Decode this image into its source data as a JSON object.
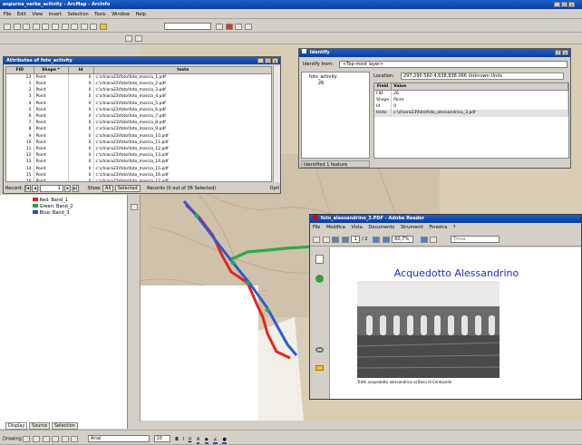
{
  "app": {
    "title": "anpurna_verbe_activity - ArcMap - ArcInfo",
    "menus": [
      "File",
      "Edit",
      "View",
      "Insert",
      "Selection",
      "Tools",
      "Window",
      "Help"
    ]
  },
  "attributes": {
    "title": "Attributes of foto_activity",
    "columns": [
      "FID",
      "Shape *",
      "Id",
      "testo"
    ],
    "rows": [
      [
        "23",
        "Point",
        "0",
        "c:\\chiara23\\foto\\foto_marcia_1.pdf"
      ],
      [
        "1",
        "Point",
        "0",
        "c:\\chiara23\\foto\\foto_marcia_2.pdf"
      ],
      [
        "2",
        "Point",
        "0",
        "c:\\chiara23\\foto\\foto_marcia_3.pdf"
      ],
      [
        "3",
        "Point",
        "0",
        "c:\\chiara23\\foto\\foto_marcia_4.pdf"
      ],
      [
        "4",
        "Point",
        "0",
        "c:\\chiara23\\foto\\foto_marcia_5.pdf"
      ],
      [
        "5",
        "Point",
        "0",
        "c:\\chiara23\\foto\\foto_marcia_6.pdf"
      ],
      [
        "6",
        "Point",
        "0",
        "c:\\chiara23\\foto\\foto_marcia_7.pdf"
      ],
      [
        "7",
        "Point",
        "0",
        "c:\\chiara23\\foto\\foto_marcia_8.pdf"
      ],
      [
        "8",
        "Point",
        "0",
        "c:\\chiara23\\foto\\foto_marcia_9.pdf"
      ],
      [
        "9",
        "Point",
        "0",
        "c:\\chiara23\\foto\\foto_marcia_10.pdf"
      ],
      [
        "10",
        "Point",
        "0",
        "c:\\chiara23\\foto\\foto_marcia_11.pdf"
      ],
      [
        "11",
        "Point",
        "0",
        "c:\\chiara23\\foto\\foto_marcia_12.pdf"
      ],
      [
        "12",
        "Point",
        "0",
        "c:\\chiara23\\foto\\foto_marcia_13.pdf"
      ],
      [
        "13",
        "Point",
        "0",
        "c:\\chiara23\\foto\\foto_marcia_14.pdf"
      ],
      [
        "14",
        "Point",
        "0",
        "c:\\chiara23\\foto\\foto_marcia_15.pdf"
      ],
      [
        "15",
        "Point",
        "0",
        "c:\\chiara23\\foto\\foto_marcia_16.pdf"
      ],
      [
        "16",
        "Point",
        "0",
        "c:\\chiara23\\foto\\foto_marcia_17.pdf"
      ],
      [
        "17",
        "Point",
        "0",
        "c:\\chiara23\\foto\\foto_marcia_18.pdf"
      ]
    ],
    "footer": {
      "record_label": "Record:",
      "record_value": "1",
      "show_label": "Show:",
      "all_label": "All",
      "selected_label": "Selected",
      "records_text": "Records (0 out of 36 Selected)",
      "options_label": "Opti"
    }
  },
  "toc": {
    "legend": [
      {
        "label": "Red: Band_1",
        "color": "#e0201b"
      },
      {
        "label": "Green: Band_2",
        "color": "#2a9d3a"
      },
      {
        "label": "Blue: Band_3",
        "color": "#2b4ec2"
      }
    ],
    "tabs": [
      "Display",
      "Source",
      "Selection"
    ]
  },
  "identify": {
    "title": "Identify",
    "identify_from_label": "Identify from:",
    "identify_from_value": "<Top-most layer>",
    "tree_root": "foto_activity",
    "tree_child": "26",
    "location_label": "Location:",
    "location_value": "297,290.560  4,638,838.066 Unknown Units",
    "columns": [
      "Field",
      "Value"
    ],
    "rows": [
      [
        "FID",
        "26"
      ],
      [
        "Shape",
        "Point"
      ],
      [
        "Id",
        "0"
      ],
      [
        "testo",
        "c:\\chiara23\\foto\\foto_alessandrino_3.pdf"
      ]
    ],
    "status": "Identified 1 feature"
  },
  "reader": {
    "title": "foto_alessandrino_3.PDF - Adobe Reader",
    "menus": [
      "File",
      "Modifica",
      "Vista",
      "Documento",
      "Strumenti",
      "Finestra",
      "?"
    ],
    "page_current": "1",
    "page_total": "/ 2",
    "zoom": "60,7%",
    "search_placeholder": "Trova",
    "doc_title": "Acquedotto Alessandrino",
    "caption": "Tratti acquedotto alessandrino al Bivio di Centocelle"
  },
  "bottom_toolbar": {
    "drawing_label": "Drawing",
    "font_name": "Arial",
    "font_size": "10"
  },
  "map": {
    "route_colors": {
      "red": "#e3261d",
      "blue": "#2d5bd6",
      "green": "#2fa84a"
    }
  }
}
